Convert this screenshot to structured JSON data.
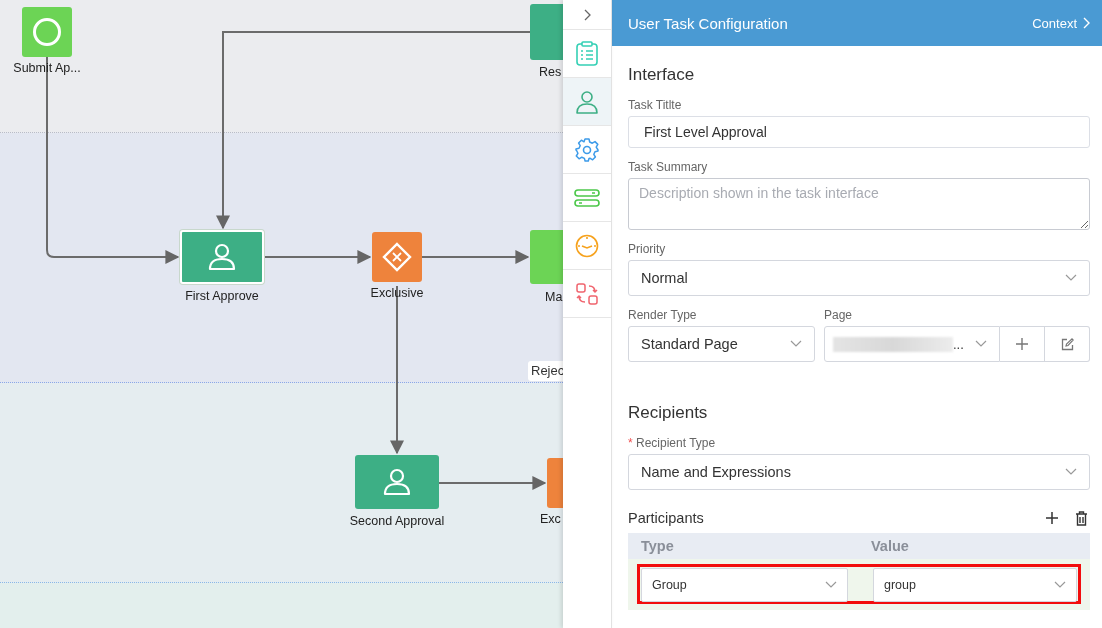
{
  "canvas": {
    "nodes": [
      {
        "kind": "start",
        "label": "Submit Ap...",
        "selected": false
      },
      {
        "kind": "task",
        "label": "Res",
        "selected": false
      },
      {
        "kind": "task",
        "label": "First Approve",
        "selected": true
      },
      {
        "kind": "gateway",
        "label": "Exclusive",
        "selected": false
      },
      {
        "kind": "service",
        "label": "Ma",
        "selected": false
      },
      {
        "kind": "task",
        "label": "Second Approval",
        "selected": false
      },
      {
        "kind": "gateway",
        "label": "Exc",
        "selected": false
      }
    ],
    "flow_labels": [
      "Rejec"
    ]
  },
  "rail": {
    "tabs": [
      {
        "selected": false
      },
      {
        "selected": true
      },
      {
        "selected": false
      },
      {
        "selected": false
      },
      {
        "selected": false
      },
      {
        "selected": false
      }
    ]
  },
  "panel": {
    "title": "User Task Configuration",
    "context_link": "Context",
    "interface": {
      "heading": "Interface",
      "task_title": {
        "label": "Task Titlte",
        "value": "First Level Approval"
      },
      "task_summary": {
        "label": "Task Summary",
        "placeholder": "Description shown in the task interface"
      },
      "priority": {
        "label": "Priority",
        "value": "Normal"
      },
      "render_type": {
        "label": "Render Type",
        "value": "Standard Page"
      },
      "page": {
        "label": "Page",
        "value": "..."
      }
    },
    "recipients": {
      "heading": "Recipients",
      "recipient_type": {
        "label": "Recipient Type",
        "required": true,
        "required_mark": "*",
        "value": "Name and Expressions"
      },
      "participants": {
        "label": "Participants",
        "columns": [
          "Type",
          "Value"
        ],
        "rows": [
          {
            "type": "Group",
            "value": "group",
            "highlighted": true
          }
        ]
      }
    }
  }
}
